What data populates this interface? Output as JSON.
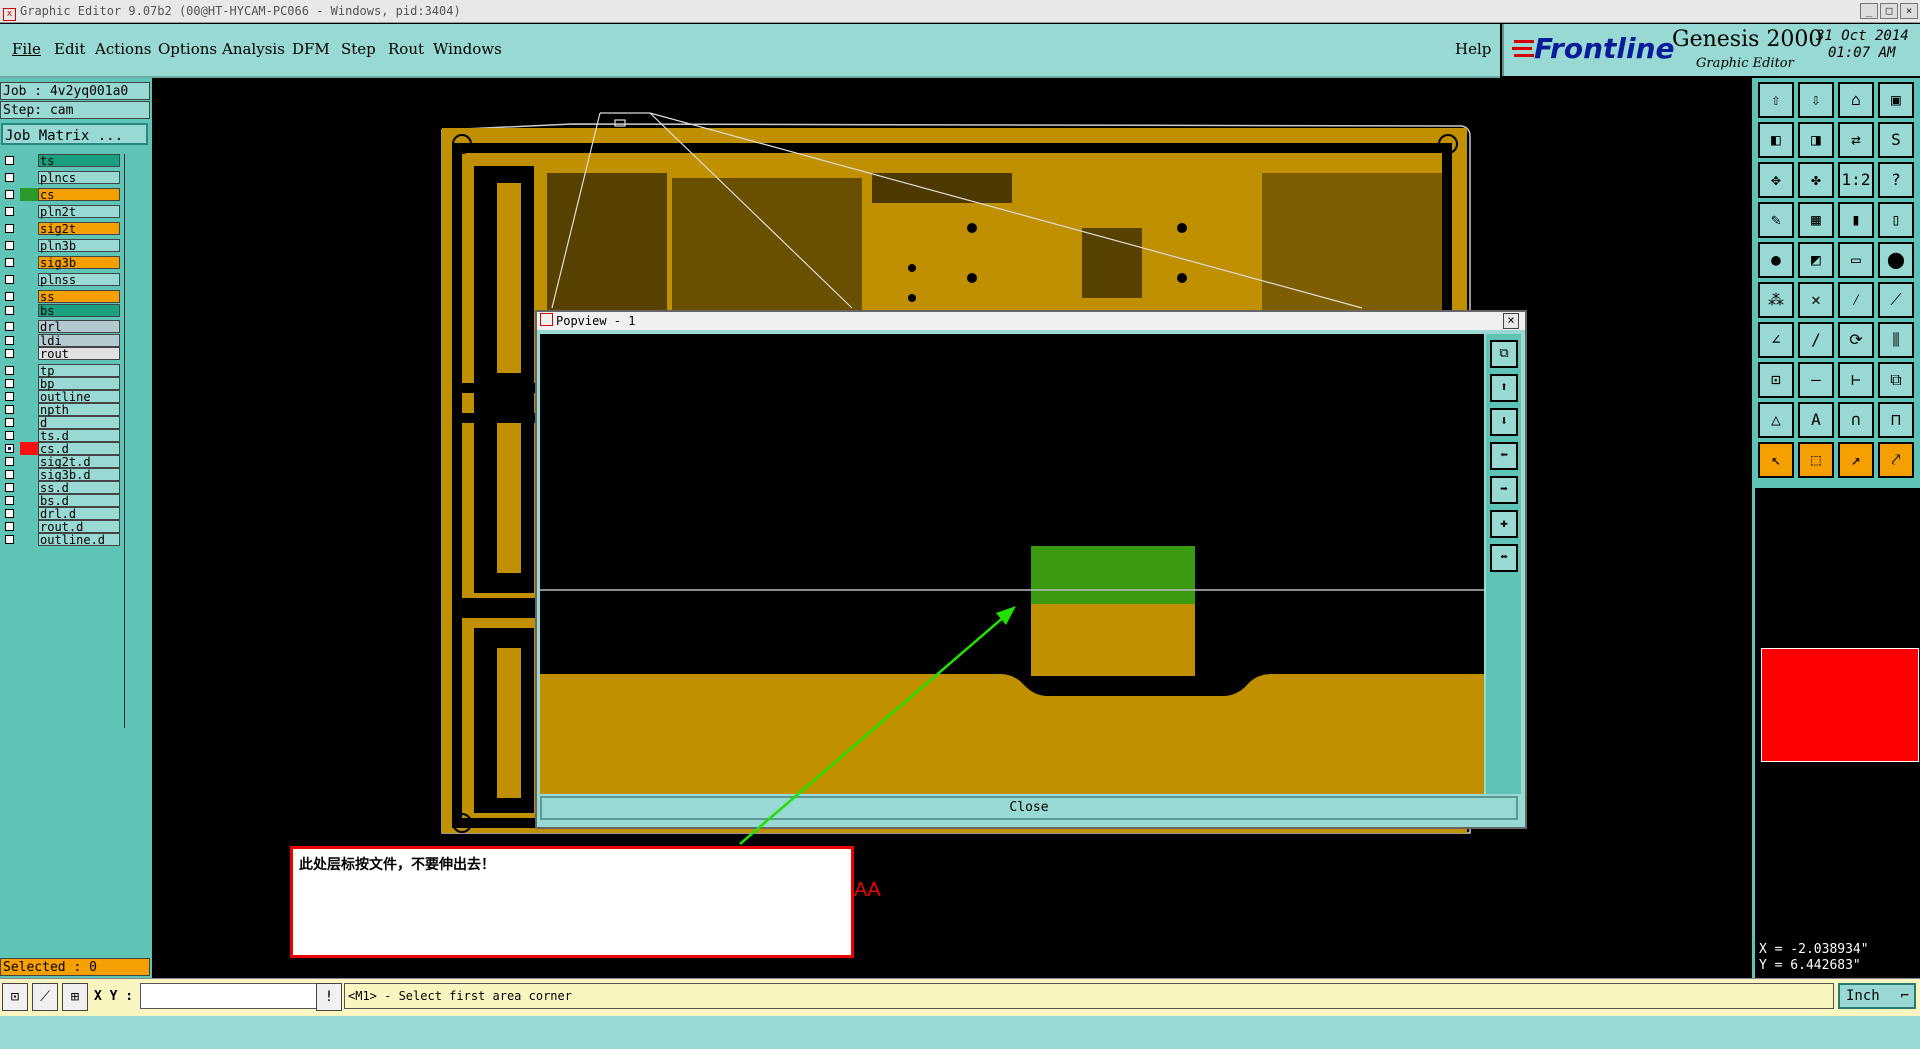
{
  "titlebar": {
    "title": "Graphic Editor 9.07b2 (00@HT-HYCAM-PC066 - Windows, pid:3404)"
  },
  "menu": {
    "items": [
      "File",
      "Edit",
      "Actions",
      "Options",
      "Analysis",
      "DFM",
      "Step",
      "Rout",
      "Windows"
    ],
    "help": "Help"
  },
  "brand": {
    "logo": "Frontline",
    "product": "Genesis 2000",
    "subtitle": "Graphic Editor",
    "date": "31 Oct 2014",
    "time": "01:07 AM"
  },
  "job": {
    "job_label": "Job : 4v2yq001a0",
    "step_label": "Step: cam",
    "matrix_button": "Job Matrix ..."
  },
  "layers": [
    {
      "name": "ts",
      "color": "#1aa080",
      "checked": false
    },
    {
      "name": "plncs",
      "color": "#99d9d4",
      "checked": false
    },
    {
      "name": "cs",
      "color": "#f5a000",
      "checked": false,
      "swatch": "#2a9a2a"
    },
    {
      "name": "pln2t",
      "color": "#99d9d4",
      "checked": false
    },
    {
      "name": "sig2t",
      "color": "#f5a000",
      "checked": false
    },
    {
      "name": "pln3b",
      "color": "#99d9d4",
      "checked": false
    },
    {
      "name": "sig3b",
      "color": "#f5a000",
      "checked": false
    },
    {
      "name": "plnss",
      "color": "#99d9d4",
      "checked": false
    },
    {
      "name": "ss",
      "color": "#f5a000",
      "checked": false
    },
    {
      "name": "bs",
      "color": "#1aa080",
      "checked": false
    },
    {
      "name": "drl",
      "color": "#b4c8d0",
      "checked": false
    },
    {
      "name": "ldi",
      "color": "#b4c8d0",
      "checked": false
    },
    {
      "name": "rout",
      "color": "#e0e0e0",
      "checked": false
    },
    {
      "name": "tp",
      "color": "#99d9d4",
      "checked": false
    },
    {
      "name": "bp",
      "color": "#99d9d4",
      "checked": false
    },
    {
      "name": "outline",
      "color": "#99d9d4",
      "checked": false
    },
    {
      "name": "npth",
      "color": "#99d9d4",
      "checked": false
    },
    {
      "name": "d",
      "color": "#99d9d4",
      "checked": false
    },
    {
      "name": "ts.d",
      "color": "#99d9d4",
      "checked": false
    },
    {
      "name": "cs.d",
      "color": "#99d9d4",
      "checked": true,
      "swatch": "#ff1010"
    },
    {
      "name": "sig2t.d",
      "color": "#99d9d4",
      "checked": false
    },
    {
      "name": "sig3b.d",
      "color": "#99d9d4",
      "checked": false
    },
    {
      "name": "ss.d",
      "color": "#99d9d4",
      "checked": false
    },
    {
      "name": "bs.d",
      "color": "#99d9d4",
      "checked": false
    },
    {
      "name": "drl.d",
      "color": "#99d9d4",
      "checked": false
    },
    {
      "name": "rout.d",
      "color": "#99d9d4",
      "checked": false
    },
    {
      "name": "outline.d",
      "color": "#99d9d4",
      "checked": false
    }
  ],
  "selected": "Selected : 0",
  "popview": {
    "title": "Popview - 1",
    "close_label": "Close"
  },
  "annotation": {
    "text": "此处层标按文件，不要伸出去！",
    "stray_text": "AA"
  },
  "coords": {
    "x": "X = -2.038934\"",
    "y": "Y = 6.442683\""
  },
  "status": {
    "xy_label": "X Y :",
    "xy_value": "",
    "prompt": "<M1> - Select first area corner",
    "units": "Inch"
  },
  "colors": {
    "panel": "#99d9d4",
    "teal": "#5ec4b6",
    "copper": "#c09000",
    "green": "#3a9a10",
    "highlight": "#f5a000",
    "red": "#ff0000"
  }
}
